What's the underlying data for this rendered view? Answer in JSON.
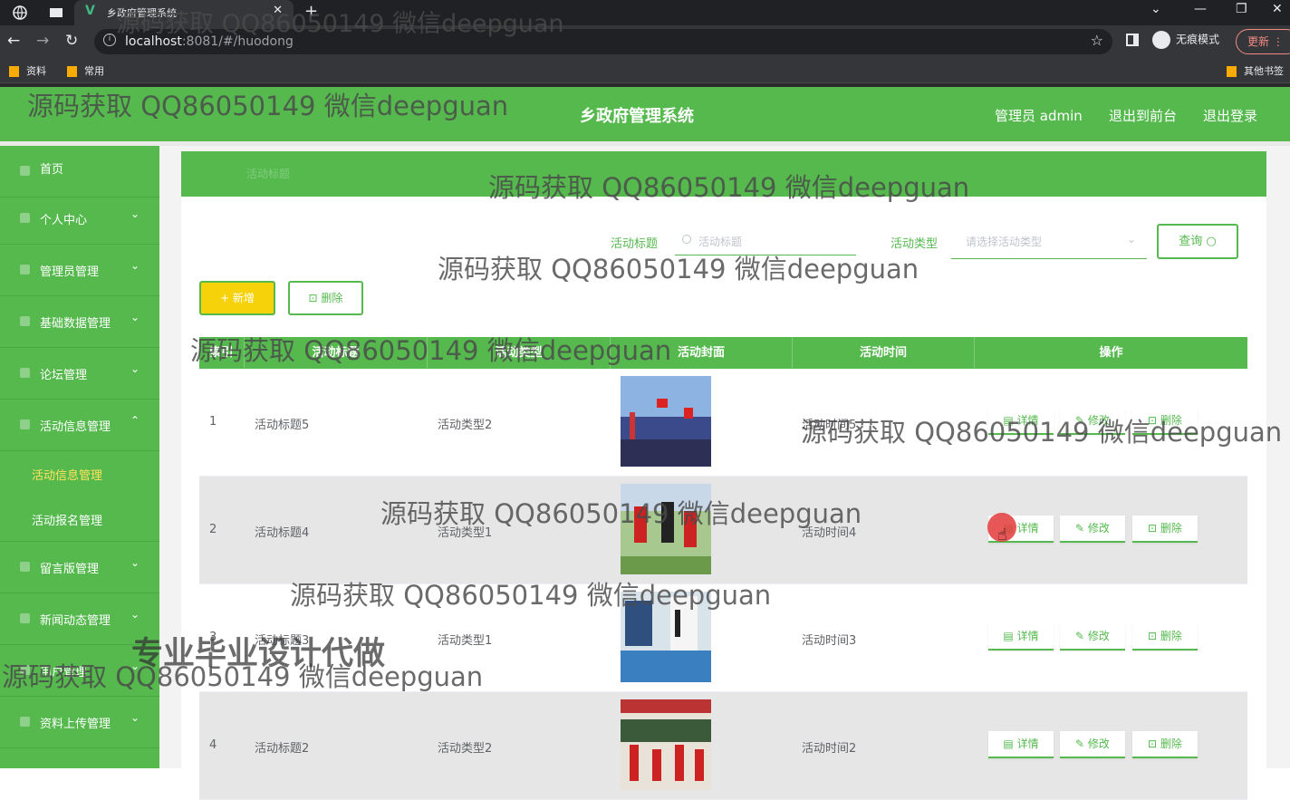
{
  "browser": {
    "tab_title": "乡政府管理系统",
    "url_host": "localhost",
    "url_rest": ":8081/#/huodong",
    "incognito_label": "无痕模式",
    "update_label": "更新",
    "bookmarks": [
      "资料",
      "常用"
    ],
    "other_bookmarks": "其他书签"
  },
  "header": {
    "site_title": "乡政府管理系统",
    "admin_label": "管理员 admin",
    "to_front_label": "退出到前台",
    "logout_label": "退出登录"
  },
  "sidebar": {
    "items": [
      {
        "label": "首页"
      },
      {
        "label": "个人中心"
      },
      {
        "label": "管理员管理"
      },
      {
        "label": "基础数据管理"
      },
      {
        "label": "论坛管理"
      },
      {
        "label": "活动信息管理"
      },
      {
        "label": "留言版管理"
      },
      {
        "label": "新闻动态管理"
      },
      {
        "label": "用户管理"
      },
      {
        "label": "资料上传管理"
      }
    ],
    "sub_items": [
      {
        "label": "活动信息管理"
      },
      {
        "label": "活动报名管理"
      }
    ]
  },
  "breadcrumb": "活动标题",
  "search": {
    "title_label": "活动标题",
    "title_placeholder": "活动标题",
    "type_label": "活动类型",
    "type_placeholder": "请选择活动类型",
    "query_label": "查询"
  },
  "toolbar": {
    "add_label": "+ 新增",
    "delete_label": "删除"
  },
  "table": {
    "columns": [
      "索引",
      "活动标题",
      "活动类型",
      "活动封面",
      "活动时间",
      "操作"
    ],
    "rows": [
      {
        "index": "1",
        "title": "活动标题5",
        "type": "活动类型2",
        "time": "活动时间5"
      },
      {
        "index": "2",
        "title": "活动标题4",
        "type": "活动类型1",
        "time": "活动时间4"
      },
      {
        "index": "3",
        "title": "活动标题3",
        "type": "活动类型1",
        "time": "活动时间3"
      },
      {
        "index": "4",
        "title": "活动标题2",
        "type": "活动类型2",
        "time": "活动时间2"
      }
    ],
    "actions": {
      "detail": "详情",
      "edit": "修改",
      "delete": "删除"
    }
  },
  "watermarks": {
    "text": "源码获取 QQ86050149 微信deepguan",
    "big": "专业毕业设计代做"
  },
  "colors": {
    "brand_green": "#55b94e",
    "add_yellow": "#f6d20a"
  }
}
